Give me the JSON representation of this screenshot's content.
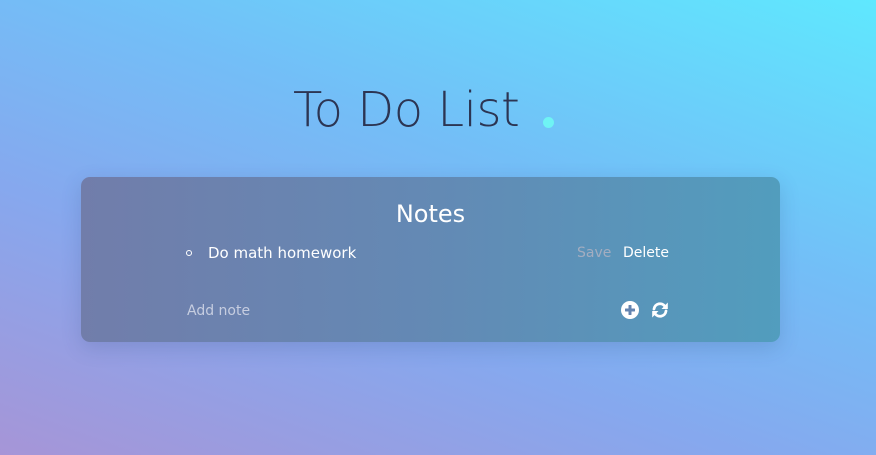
{
  "header": {
    "title": "To Do List"
  },
  "card": {
    "title": "Notes",
    "notes": [
      {
        "text": "Do math homework",
        "save_label": "Save",
        "delete_label": "Delete"
      }
    ],
    "add_input": {
      "value": "",
      "placeholder": "Add note"
    },
    "icons": {
      "add": "plus-circle-icon",
      "refresh": "refresh-icon"
    }
  },
  "colors": {
    "gradient_start": "#a695d7",
    "gradient_end": "#5fe8fe",
    "title_text": "#2c3553",
    "title_dot": "#6ff3f4",
    "save_muted": "#a3adc0"
  }
}
